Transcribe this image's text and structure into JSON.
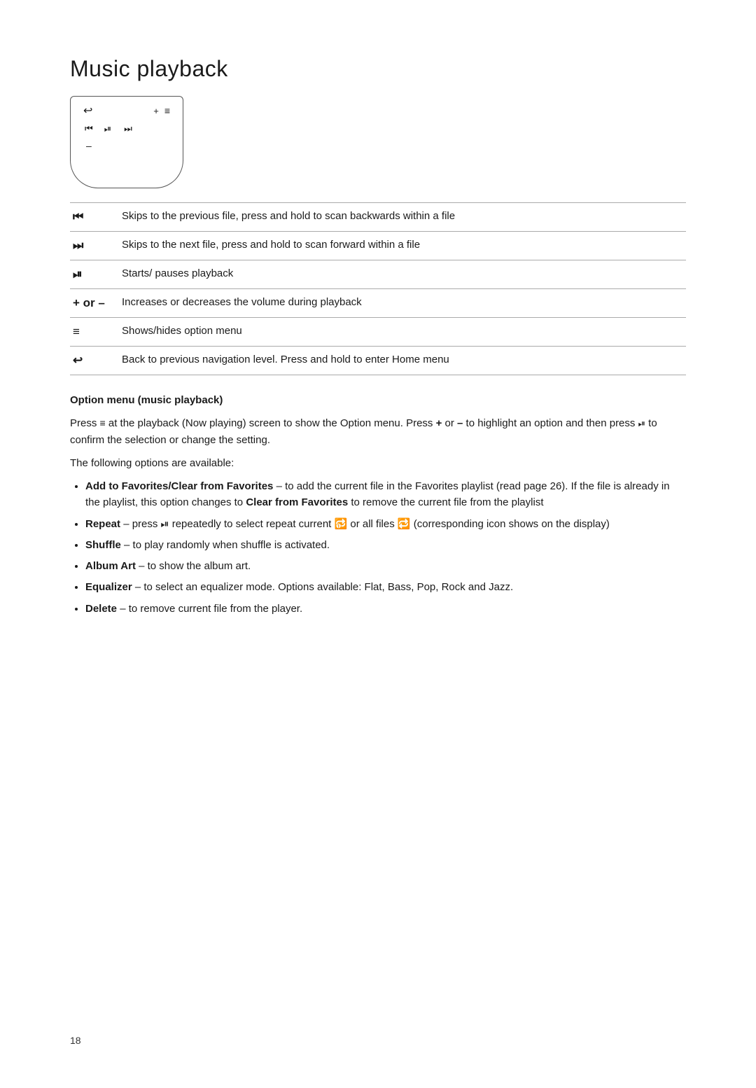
{
  "page": {
    "title": "Music playback",
    "number": "18"
  },
  "diagram": {
    "back_symbol": "↩",
    "plus_symbol": "+",
    "menu_symbol": "≡",
    "prev_symbol": "⏮",
    "play_symbol": "⏯",
    "next_symbol": "⏭",
    "minus_symbol": "–"
  },
  "controls": [
    {
      "icon": "⏮",
      "description": "Skips to the previous file, press and hold to scan backwards within a file"
    },
    {
      "icon": "⏭",
      "description": "Skips to the next file, press and hold to scan forward within a file"
    },
    {
      "icon": "⏯",
      "description": "Starts/ pauses playback"
    },
    {
      "icon": "+ or –",
      "description": "Increases or decreases the volume during playback"
    },
    {
      "icon": "≡",
      "description": "Shows/hides option menu"
    },
    {
      "icon": "↩",
      "description": "Back to previous navigation level. Press and hold to enter Home menu"
    }
  ],
  "option_menu": {
    "section_title": "Option menu (music playback)",
    "intro_text": " at the playback (Now playing) screen to show the Option menu. Press ",
    "intro_prefix": "Press ",
    "intro_icon1": "≡",
    "intro_plus": "+",
    "intro_or": " or ",
    "intro_minus": "–",
    "intro_middle": " to highlight an option and then press ",
    "intro_icon2": "⏯",
    "intro_suffix": " to confirm the selection or change the setting.",
    "available_text": "The following options are available:",
    "options": [
      {
        "label": "Add to Favorites/Clear from Favorites",
        "text": " – to add the current file in the Favorites playlist (read page 26). If the file is already in the playlist, this option changes to ",
        "bold2": "Clear from Favorites",
        "text2": " to remove the current file from the playlist"
      },
      {
        "label": "Repeat",
        "text": " – press ⏯ repeatedly to select repeat current 🔂 or all files 🔁 (corresponding icon shows on the display)"
      },
      {
        "label": "Shuffle",
        "text": " – to play randomly when shuffle is activated."
      },
      {
        "label": "Album Art",
        "text": " – to show the album art."
      },
      {
        "label": "Equalizer",
        "text": " – to select an equalizer mode. Options available: Flat, Bass, Pop, Rock and Jazz."
      },
      {
        "label": "Delete",
        "text": " – to remove current file from the player."
      }
    ]
  }
}
